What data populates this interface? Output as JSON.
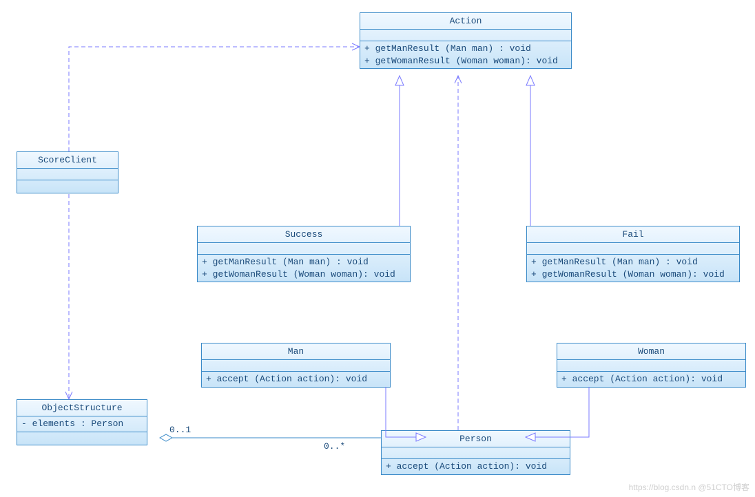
{
  "classes": {
    "action": {
      "name": "Action",
      "op1": "+ getManResult (Man man)     : void",
      "op2": "+ getWomanResult (Woman woman): void"
    },
    "scoreclient": {
      "name": "ScoreClient"
    },
    "success": {
      "name": "Success",
      "op1": "+ getManResult (Man man)     : void",
      "op2": "+ getWomanResult (Woman woman): void"
    },
    "fail": {
      "name": "Fail",
      "op1": "+ getManResult (Man man)     : void",
      "op2": "+ getWomanResult (Woman woman): void"
    },
    "man": {
      "name": "Man",
      "op1": "+ accept (Action action): void"
    },
    "woman": {
      "name": "Woman",
      "op1": "+ accept (Action action): void"
    },
    "objectstructure": {
      "name": "ObjectStructure",
      "attr1": "- elements : Person"
    },
    "person": {
      "name": "Person",
      "op1": "+ accept (Action action): void"
    }
  },
  "multiplicities": {
    "obj_person_src": "0..1",
    "obj_person_dst": "0..*"
  },
  "watermark": "https://blog.csdn.n @51CTO博客"
}
